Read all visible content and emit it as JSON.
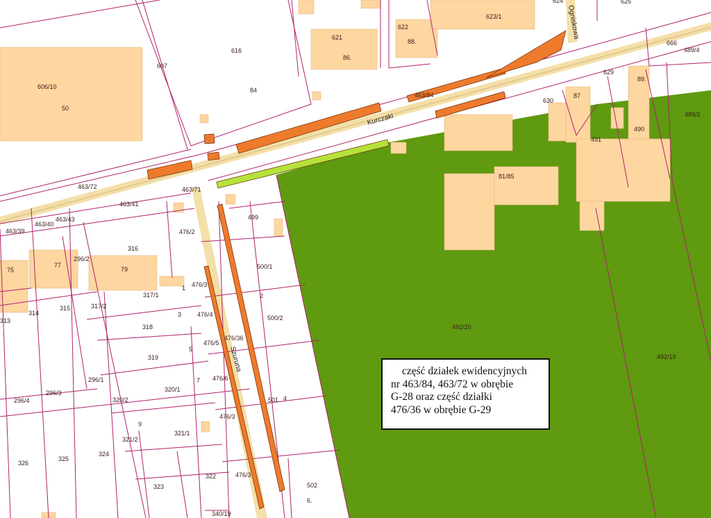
{
  "streets": {
    "kurczaki": "Kurczaki",
    "szuruna": "Szuruna",
    "ogniskowa": "Ogniskowa"
  },
  "parcels": {
    "p616": "616",
    "p84": "84",
    "p607": "607",
    "p606_10": "606/10",
    "p50": "50",
    "p621": "621",
    "p86": "86.",
    "p622": "622",
    "p88": "88.",
    "p623_1": "623/1",
    "p624": "624",
    "p625": "625",
    "p666": "666",
    "p489_4": "489/4",
    "p629": "629",
    "p89": "89.",
    "p489_2": "489/2",
    "p630": "630",
    "p87": "87",
    "p490": "490",
    "p491": "491",
    "p463_84": "463/84",
    "p81_85": "81/85",
    "p463_72": "463/72",
    "p463_71": "463/71",
    "p463_41": "463/41",
    "p463_39": "463/39",
    "p463_40": "463/40",
    "p463_43": "463/43",
    "p476_2": "476/2",
    "p499": "499",
    "p316": "316",
    "p296_2": "296/2",
    "p75": "75",
    "p77": "77",
    "p79": "79",
    "p500_1": "500/1",
    "p1": "1",
    "p476_3a": "476/3",
    "p317_1": "317/1",
    "p317_2": "317/2",
    "p2": "2",
    "p315": "315",
    "p314": "314",
    "p313": "313",
    "p3": "3",
    "p476_4": "476/4",
    "p500_2": "500/2",
    "p318": "318",
    "p476_36": "476/36",
    "p5": "5",
    "p476_5": "476/5",
    "p319": "319",
    "p492_20": "492/20",
    "p492_19": "492/19",
    "p7": "7",
    "p476_6": "476/6",
    "p320_1": "320/1",
    "p296_1": "296/1",
    "p296_4": "296/4",
    "p296_3": "296/3",
    "p320_2": "320/2",
    "p501": "501",
    "p4": "4",
    "p476_3b": "476/3",
    "p9": "9",
    "p321_1": "321/1",
    "p321_2": "321/2",
    "p326": "326",
    "p325": "325",
    "p324": "324",
    "p322": "322",
    "p476_3c": "476/3",
    "p323": "323",
    "p502": "502",
    "p6": "6.",
    "p340_19": "340/19"
  },
  "legend": {
    "line1": "część działek ewidencyjnych",
    "line2": "nr 463/84, 463/72 w obrębie",
    "line3": "G-28 oraz część działki",
    "line4": "476/36 w obrębie G-29"
  },
  "colors": {
    "green_area": "#5f9a10",
    "highlight_orange": "#ee7a2c",
    "highlight_lime": "#b5e23a",
    "building": "#fdd6a0",
    "road": "#f4dfa8",
    "parcel_line": "#b0226b"
  }
}
